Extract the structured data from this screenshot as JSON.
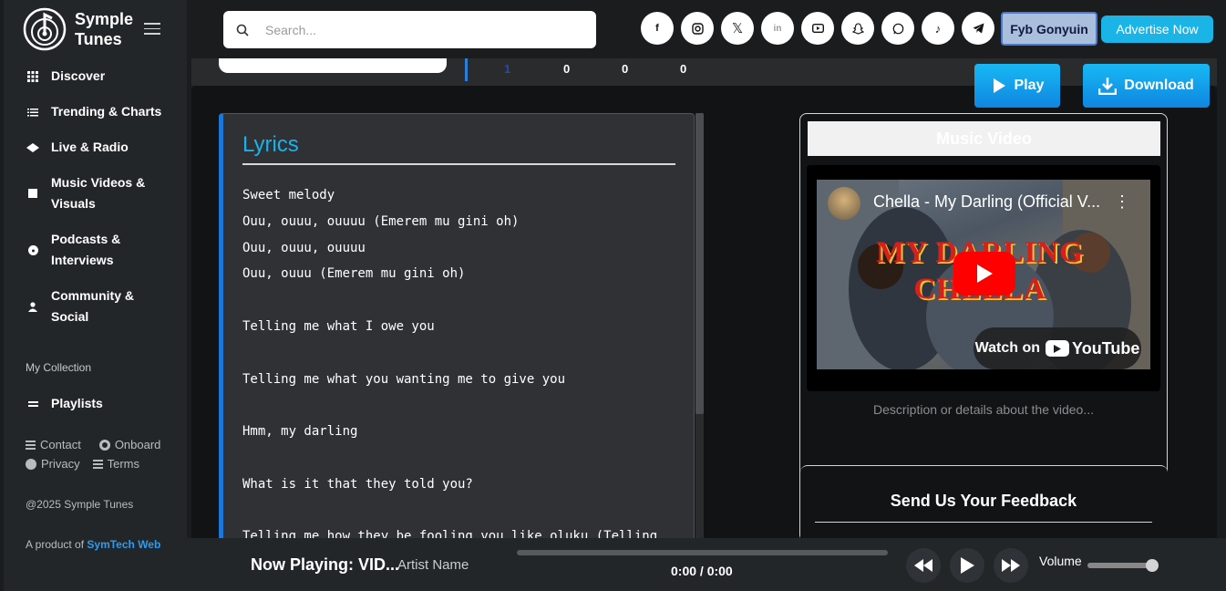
{
  "brand": {
    "line1": "Symple",
    "line2": "Tunes"
  },
  "sidebar": {
    "items": [
      {
        "label": "Discover",
        "icon": "grid-icon"
      },
      {
        "label": "Trending & Charts",
        "icon": "list-icon"
      },
      {
        "label": "Live & Radio",
        "icon": "broadcast-icon"
      },
      {
        "label": "Music Videos &\nVisuals",
        "icon": "video-icon"
      },
      {
        "label": "Podcasts &\nInterviews",
        "icon": "podcast-icon"
      },
      {
        "label": "Community &\nSocial",
        "icon": "user-icon"
      }
    ],
    "section_label": "My Collection",
    "playlists_label": "Playlists",
    "footer_links": [
      "Contact",
      "Onboard",
      "Privacy",
      "Terms"
    ],
    "copyright": "@2025 Symple Tunes",
    "product_prefix": "A product of ",
    "product_link": "SymTech Web"
  },
  "header": {
    "search_placeholder": "Search...",
    "social_icons": [
      "facebook-icon",
      "instagram-icon",
      "x-icon",
      "linkedin-icon",
      "youtube-icon",
      "snapchat-icon",
      "whatsapp-icon",
      "tiktok-icon",
      "telegram-icon"
    ],
    "user_button": "Fyb Gonyuin",
    "advertise_button": "Advertise Now"
  },
  "stats": [
    "1",
    "0",
    "0",
    "0"
  ],
  "actions": {
    "play": "Play",
    "download": "Download"
  },
  "lyrics": {
    "title": "Lyrics",
    "text": "Sweet melody\nOuu, ouuu, ouuuu (Emerem mu gini oh)\nOuu, ouuu, ouuuu\nOuu, ouuu (Emerem mu gini oh)\n\nTelling me what I owe you\n\nTelling me what you wanting me to give you\n\nHmm, my darling\n\nWhat is it that they told you?\n\nTelling me how they be fooling you like oluku (Telling"
  },
  "video": {
    "panel_title": "Music Video",
    "yt_title": "Chella - My Darling (Official V...",
    "art_line1": "MY DARLING",
    "art_line2": "CHELLA",
    "watch_on": "Watch on",
    "yt_brand": "YouTube",
    "description": "Description or details about the video..."
  },
  "feedback": {
    "title": "Send Us Your Feedback"
  },
  "player": {
    "now_playing": "Now Playing: VID...",
    "artist": "Artist Name",
    "time": "0:00 / 0:00",
    "volume_label": "Volume",
    "progress": 0,
    "volume": 0.85
  },
  "colors": {
    "accent": "#17b3ee",
    "lyrics_border": "#1f76d9",
    "youtube_red": "#ff0000"
  }
}
